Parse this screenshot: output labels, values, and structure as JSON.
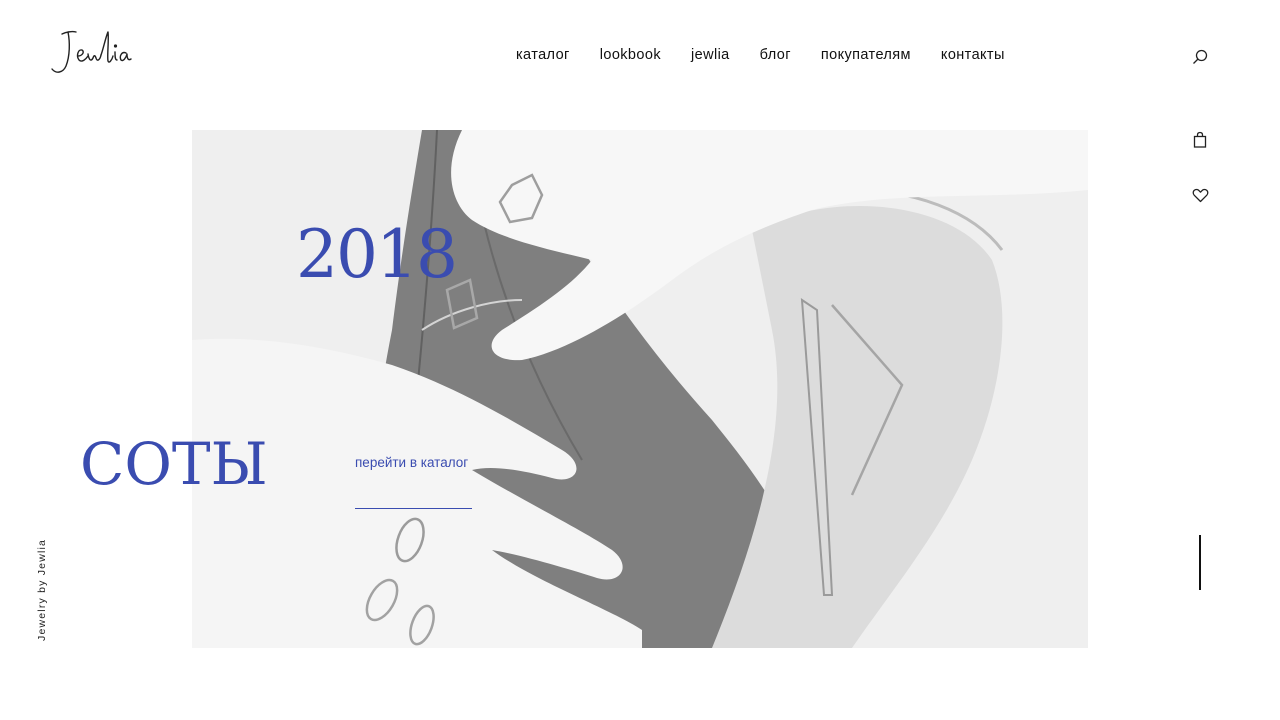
{
  "brand": {
    "logo_text": "Jewlia"
  },
  "nav": {
    "items": [
      {
        "label": "каталог"
      },
      {
        "label": "lookbook"
      },
      {
        "label": "jewlia"
      },
      {
        "label": "блог"
      },
      {
        "label": "покупателям"
      },
      {
        "label": "контакты"
      }
    ]
  },
  "icons": {
    "search": "search-icon",
    "cart": "shopping-bag-icon",
    "wishlist": "heart-icon"
  },
  "hero": {
    "year": "2018",
    "collection_title": "СОТЫ",
    "cta_label": "перейти в каталог"
  },
  "side": {
    "vertical_caption": "Jewelry by Jewlia"
  },
  "colors": {
    "accent": "#3a4cb0",
    "text": "#111111",
    "background": "#ffffff"
  }
}
